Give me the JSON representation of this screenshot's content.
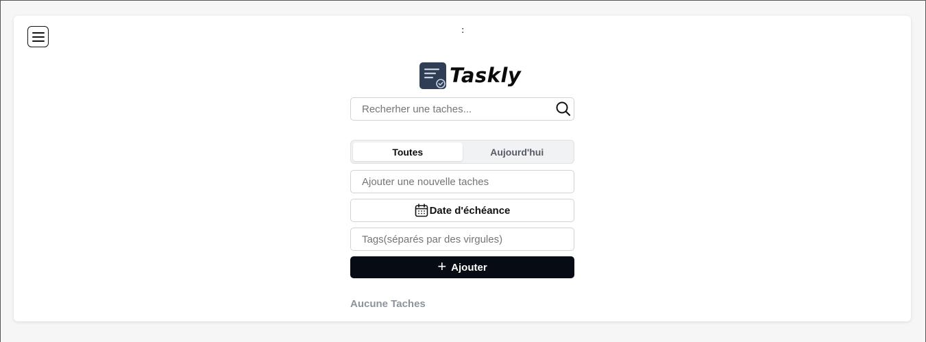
{
  "header": {
    "separator_text": ":"
  },
  "brand": {
    "name": "Taskly",
    "logo_color": "#2f3e55"
  },
  "search": {
    "placeholder": "Recherher une taches...",
    "icon": "search-icon"
  },
  "tabs": [
    {
      "label": "Toutes",
      "active": true
    },
    {
      "label": "Aujourd'hui",
      "active": false
    }
  ],
  "form": {
    "new_task_placeholder": "Ajouter une nouvelle taches",
    "due_date_label": "Date d'échéance",
    "due_date_icon": "calendar-icon",
    "tags_placeholder": "Tags(séparés par des virgules)",
    "add_label": "Ajouter",
    "add_icon": "plus-icon"
  },
  "tasks": {
    "empty_text": "Aucune Taches"
  },
  "colors": {
    "primary_button": "#070b14",
    "muted_text": "#8d939d"
  }
}
